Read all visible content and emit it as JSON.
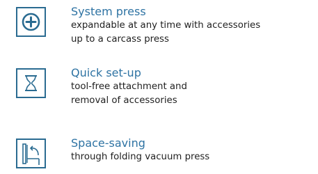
{
  "colors": {
    "title": "#2e73a3",
    "icon": "#2a6b91",
    "description": "#1f1f1f",
    "background": "#ffffff"
  },
  "features": [
    {
      "icon": "plus-circle-icon",
      "title": "System press",
      "description_line1": "expandable at any time with accessories",
      "description_line2": "up to a carcass press"
    },
    {
      "icon": "hourglass-icon",
      "title": "Quick set-up",
      "description_line1": "tool-free attachment and",
      "description_line2": "removal of accessories"
    },
    {
      "icon": "folding-press-icon",
      "title": "Space-saving",
      "description_line1": "through folding vacuum press"
    }
  ]
}
